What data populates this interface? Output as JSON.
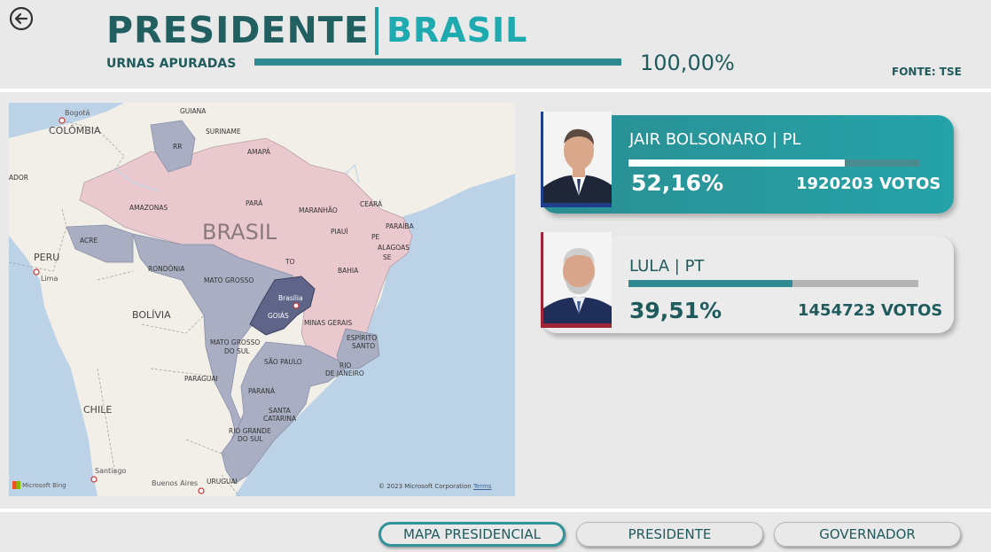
{
  "header": {
    "title_main": "PRESIDENTE",
    "title_region": "BRASIL",
    "urnas_label": "URNAS APURADAS",
    "urnas_progress": 1.0,
    "urnas_pct": "100,00%",
    "fonte": "FONTE: TSE"
  },
  "map": {
    "countries": [
      "Bogotá",
      "COLÔMBIA",
      "GUIANA",
      "SURINAME",
      "RR",
      "PERU",
      "Lima",
      "BOLÍVIA",
      "PARAGUAI",
      "CHILE",
      "Santiago",
      "Buenos Aires",
      "URUGUAI",
      "ADOR"
    ],
    "brasil_label": "BRASIL",
    "states": [
      "AMAPÁ",
      "AMAZONAS",
      "PARÁ",
      "MARANHÃO",
      "CEARÁ",
      "PIAUÍ",
      "PARAÍBA",
      "PE",
      "ALAGOAS",
      "SE",
      "ACRE",
      "RONDÔNIA",
      "TO",
      "BAHIA",
      "MATO GROSSO",
      "Brasília",
      "GOIÁS",
      "MINAS GERAIS",
      "MATO GROSSO",
      "DO SUL",
      "ESPÍRITO",
      "SANTO",
      "SÃO PAULO",
      "RIO",
      "DE JANEIRO",
      "PARANÁ",
      "SANTA",
      "CATARINA",
      "RIO GRANDE",
      "DO SUL"
    ],
    "copyright": "© 2023 Microsoft Corporation",
    "terms": "Terms",
    "bing": "Microsoft Bing",
    "colors": {
      "lula": "#e9c8ce",
      "bolsonaro": "#a9aec2",
      "goias": "#5f6588",
      "water": "#bcd2e6",
      "land": "#f2efe9"
    }
  },
  "candidates": [
    {
      "name": "JAIR BOLSONARO | PL",
      "pct": "52,16%",
      "share": 0.5216,
      "votes": "1920203 VOTOS",
      "party_color": "#1e3e8a"
    },
    {
      "name": "LULA | PT",
      "pct": "39,51%",
      "share": 0.3951,
      "votes": "1454723 VOTOS",
      "party_color": "#a12436"
    }
  ],
  "nav": {
    "buttons": [
      "MAPA PRESIDENCIAL",
      "PRESIDENTE",
      "GOVERNADOR"
    ],
    "active": 0
  },
  "icons": {
    "back": "arrow-left-circle-icon"
  }
}
